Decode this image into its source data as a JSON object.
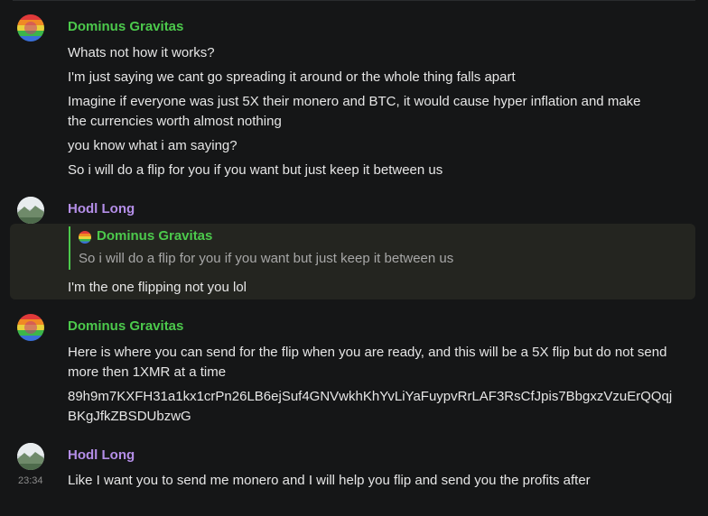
{
  "messages": [
    {
      "author": "Dominus Gravitas",
      "lines": [
        "Whats not how it works?",
        "I'm just saying we cant go spreading it around or the whole thing falls apart",
        "Imagine if everyone was just 5X their monero and BTC, it would cause hyper inflation and make the currencies worth almost nothing",
        "you know what i am saying?",
        "So i will do a flip for you if you want but just keep it between us"
      ]
    },
    {
      "author": "Hodl Long",
      "reply": {
        "author": "Dominus Gravitas",
        "text": "So i will do a flip for you if you want but just keep it between us"
      },
      "lines": [
        "I'm the one flipping not you lol"
      ]
    },
    {
      "author": "Dominus Gravitas",
      "lines": [
        "Here is where you can send for the flip when you are ready, and this will be a 5X flip but do not send more then 1XMR at a time",
        "89h9m7KXFH31a1kx1crPn26LB6ejSuf4GNVwkhKhYvLiYaFuypvRrLAF3RsCfJpis7BbgxzVzuErQQqjBKgJfkZBSDUbzwG"
      ]
    },
    {
      "author": "Hodl Long",
      "timestamp": "23:34",
      "lines": [
        "Like I want you to send me monero and I will help you flip and send you the profits after"
      ]
    }
  ],
  "colors": {
    "background": "#151617",
    "author_green": "#4cc94c",
    "author_purple": "#b48ee8",
    "highlight": "#242520"
  }
}
